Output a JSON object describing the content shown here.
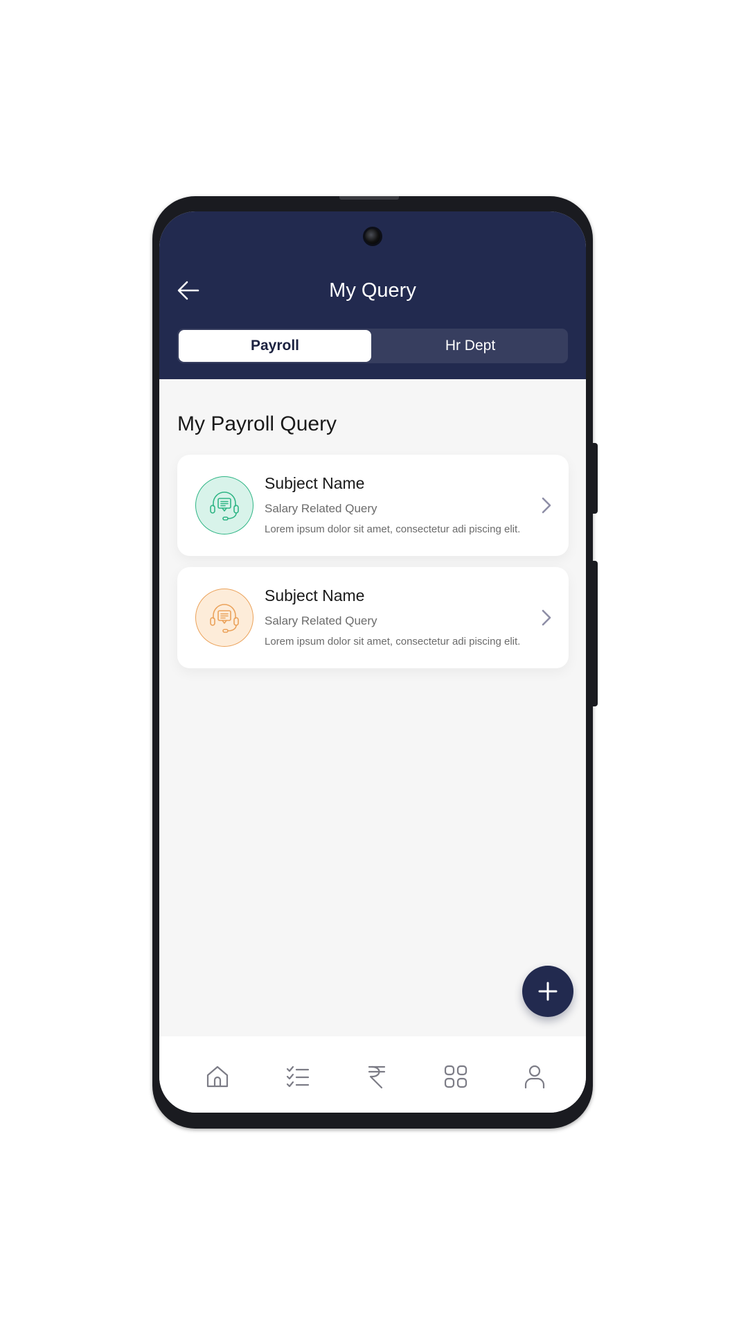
{
  "header": {
    "title": "My Query",
    "back_icon": "arrow-left-icon"
  },
  "tabs": [
    {
      "label": "Payroll",
      "active": true
    },
    {
      "label": "Hr Dept",
      "active": false
    }
  ],
  "section": {
    "title": "My Payroll Query"
  },
  "queries": [
    {
      "subject": "Subject Name",
      "category": "Salary Related Query",
      "description": "Lorem ipsum dolor sit amet, consectetur adi piscing elit.",
      "icon": "headset-support-icon",
      "accent": "#2fb585"
    },
    {
      "subject": "Subject Name",
      "category": "Salary Related Query",
      "description": "Lorem ipsum dolor sit amet, consectetur adi piscing elit.",
      "icon": "headset-support-icon",
      "accent": "#eba25a"
    }
  ],
  "fab": {
    "icon": "plus-icon"
  },
  "bottom_nav": [
    {
      "icon": "home-icon"
    },
    {
      "icon": "checklist-icon"
    },
    {
      "icon": "rupee-icon"
    },
    {
      "icon": "grid-icon"
    },
    {
      "icon": "user-icon"
    }
  ],
  "colors": {
    "primary": "#222a4f",
    "background": "#f6f6f6",
    "text_muted": "#6b6b6b"
  }
}
